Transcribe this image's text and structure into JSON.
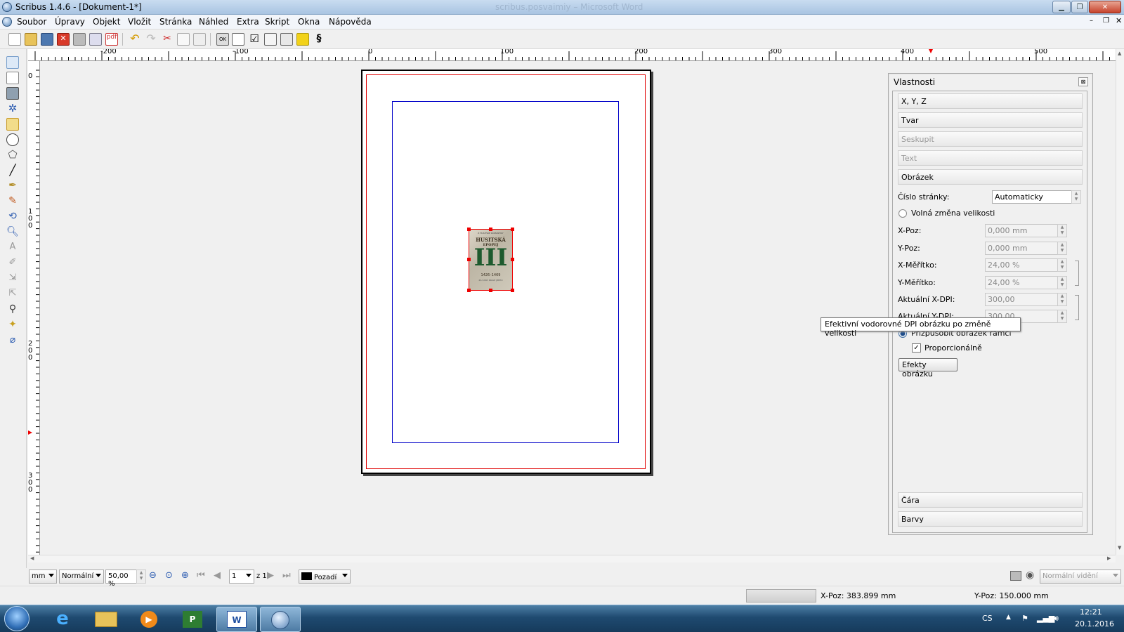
{
  "window": {
    "title": "Scribus 1.4.6 - [Dokument-1*]",
    "background_title": "scribus.posvaimiy – Microsoft Word"
  },
  "menu": [
    "Soubor",
    "Úpravy",
    "Objekt",
    "Vložit",
    "Stránka",
    "Náhled",
    "Extra",
    "Skript",
    "Okna",
    "Nápověda"
  ],
  "ruler": {
    "h_labels": [
      "-200",
      "-100",
      "0",
      "100",
      "200",
      "300",
      "400",
      "500"
    ],
    "v_labels": [
      "0",
      "1\n0\n0",
      "2\n0\n0",
      "3\n0\n0"
    ]
  },
  "book": {
    "top": "Z HUSITSKÉ ROMANTIKY",
    "title1": "HUSITSKÁ",
    "title2": "EPOPEJ",
    "numeral": "III",
    "years": "1426–1469",
    "sub": "ZA ČASŮ KRÁLE JIŘÍHO"
  },
  "props": {
    "title": "Vlastnosti",
    "sections_top": [
      "X, Y, Z",
      "Tvar",
      "Seskupit",
      "Text",
      "Obrázek"
    ],
    "sections_bottom": [
      "Čára",
      "Barvy"
    ],
    "page_num_label": "Číslo stránky:",
    "page_num_value": "Automaticky",
    "free_scale": "Volná změna velikosti",
    "rows": [
      {
        "label": "X-Poz:",
        "value": "0,000 mm"
      },
      {
        "label": "Y-Poz:",
        "value": "0,000 mm"
      },
      {
        "label": "X-Měřítko:",
        "value": "24,00 %"
      },
      {
        "label": "Y-Měřítko:",
        "value": "24,00 %"
      },
      {
        "label": "Aktuální X-DPI:",
        "value": "300,00"
      },
      {
        "label": "Aktuální Y-DPI:",
        "value": "300,00"
      }
    ],
    "fit_frame": "Přizpůsobit obrázek rámci",
    "proportional": "Proporcionálně",
    "effects": "Efekty obrázku"
  },
  "tooltip": "Efektivní vodorovné DPI obrázku po změně velikosti",
  "bottom": {
    "unit": "mm",
    "mode": "Normální",
    "zoom": "50,00 %",
    "page": "1",
    "of": "z 1",
    "layer": "Pozadí",
    "view": "Normální vidění"
  },
  "status": {
    "xpos": "X-Poz:  383.899 mm",
    "ypos": "Y-Poz:  150.000 mm"
  },
  "tray": {
    "lang": "CS",
    "time": "12:21",
    "date": "20.1.2016"
  },
  "colors": {
    "accent": "#e00000",
    "margin": "#0000c8"
  }
}
